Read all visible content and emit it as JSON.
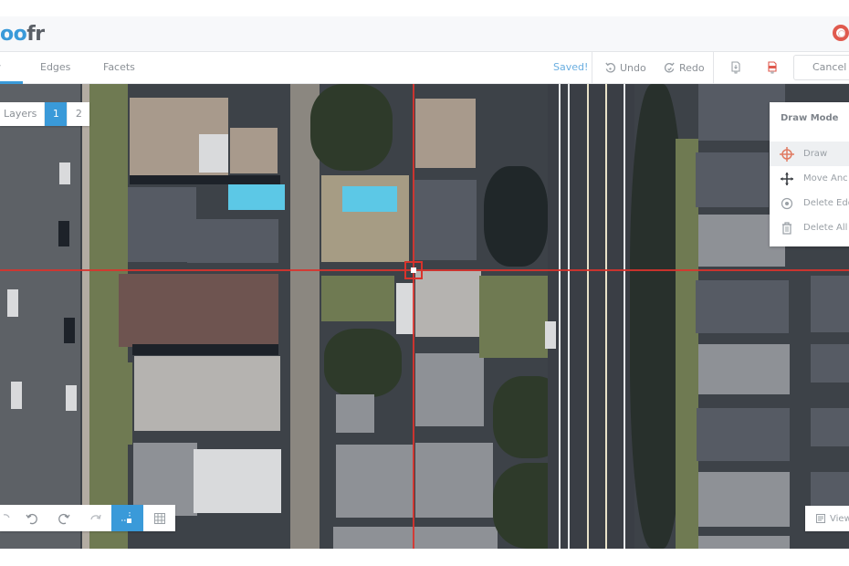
{
  "header": {
    "logo_part1": "oo",
    "logo_part2": "fr",
    "help_icon": "lifebuoy-icon"
  },
  "toolbar": {
    "tabs": [
      {
        "label": "w",
        "active": true
      },
      {
        "label": "Edges",
        "active": false
      },
      {
        "label": "Facets",
        "active": false
      }
    ],
    "status": "Saved!",
    "undo_label": "Undo",
    "redo_label": "Redo",
    "icons": [
      "download-pdf-icon",
      "report-pdf-icon"
    ],
    "cancel_label": "Cancel"
  },
  "layers": {
    "label": "Layers",
    "buttons": [
      "1",
      "2"
    ],
    "active": "1"
  },
  "draw_mode": {
    "title": "Draw Mode",
    "items": [
      {
        "label": "Draw",
        "icon": "crosshair-icon",
        "active": true
      },
      {
        "label": "Move Anc",
        "icon": "move-icon",
        "active": false
      },
      {
        "label": "Delete Edg",
        "icon": "delete-edge-icon",
        "active": false
      },
      {
        "label": "Delete All",
        "icon": "trash-icon",
        "active": false
      }
    ]
  },
  "bottom_tools": {
    "items": [
      "rotate-left-icon",
      "undo-icon",
      "redo-icon",
      "rotate-right-icon",
      "snap-point-icon",
      "grid-icon"
    ],
    "active": "snap-point-icon"
  },
  "view_button": {
    "label": "View",
    "icon": "view-icon"
  },
  "colors": {
    "accent": "#3a9ad9",
    "crosshair": "#d9332c",
    "saved_text": "#6aaee0"
  }
}
